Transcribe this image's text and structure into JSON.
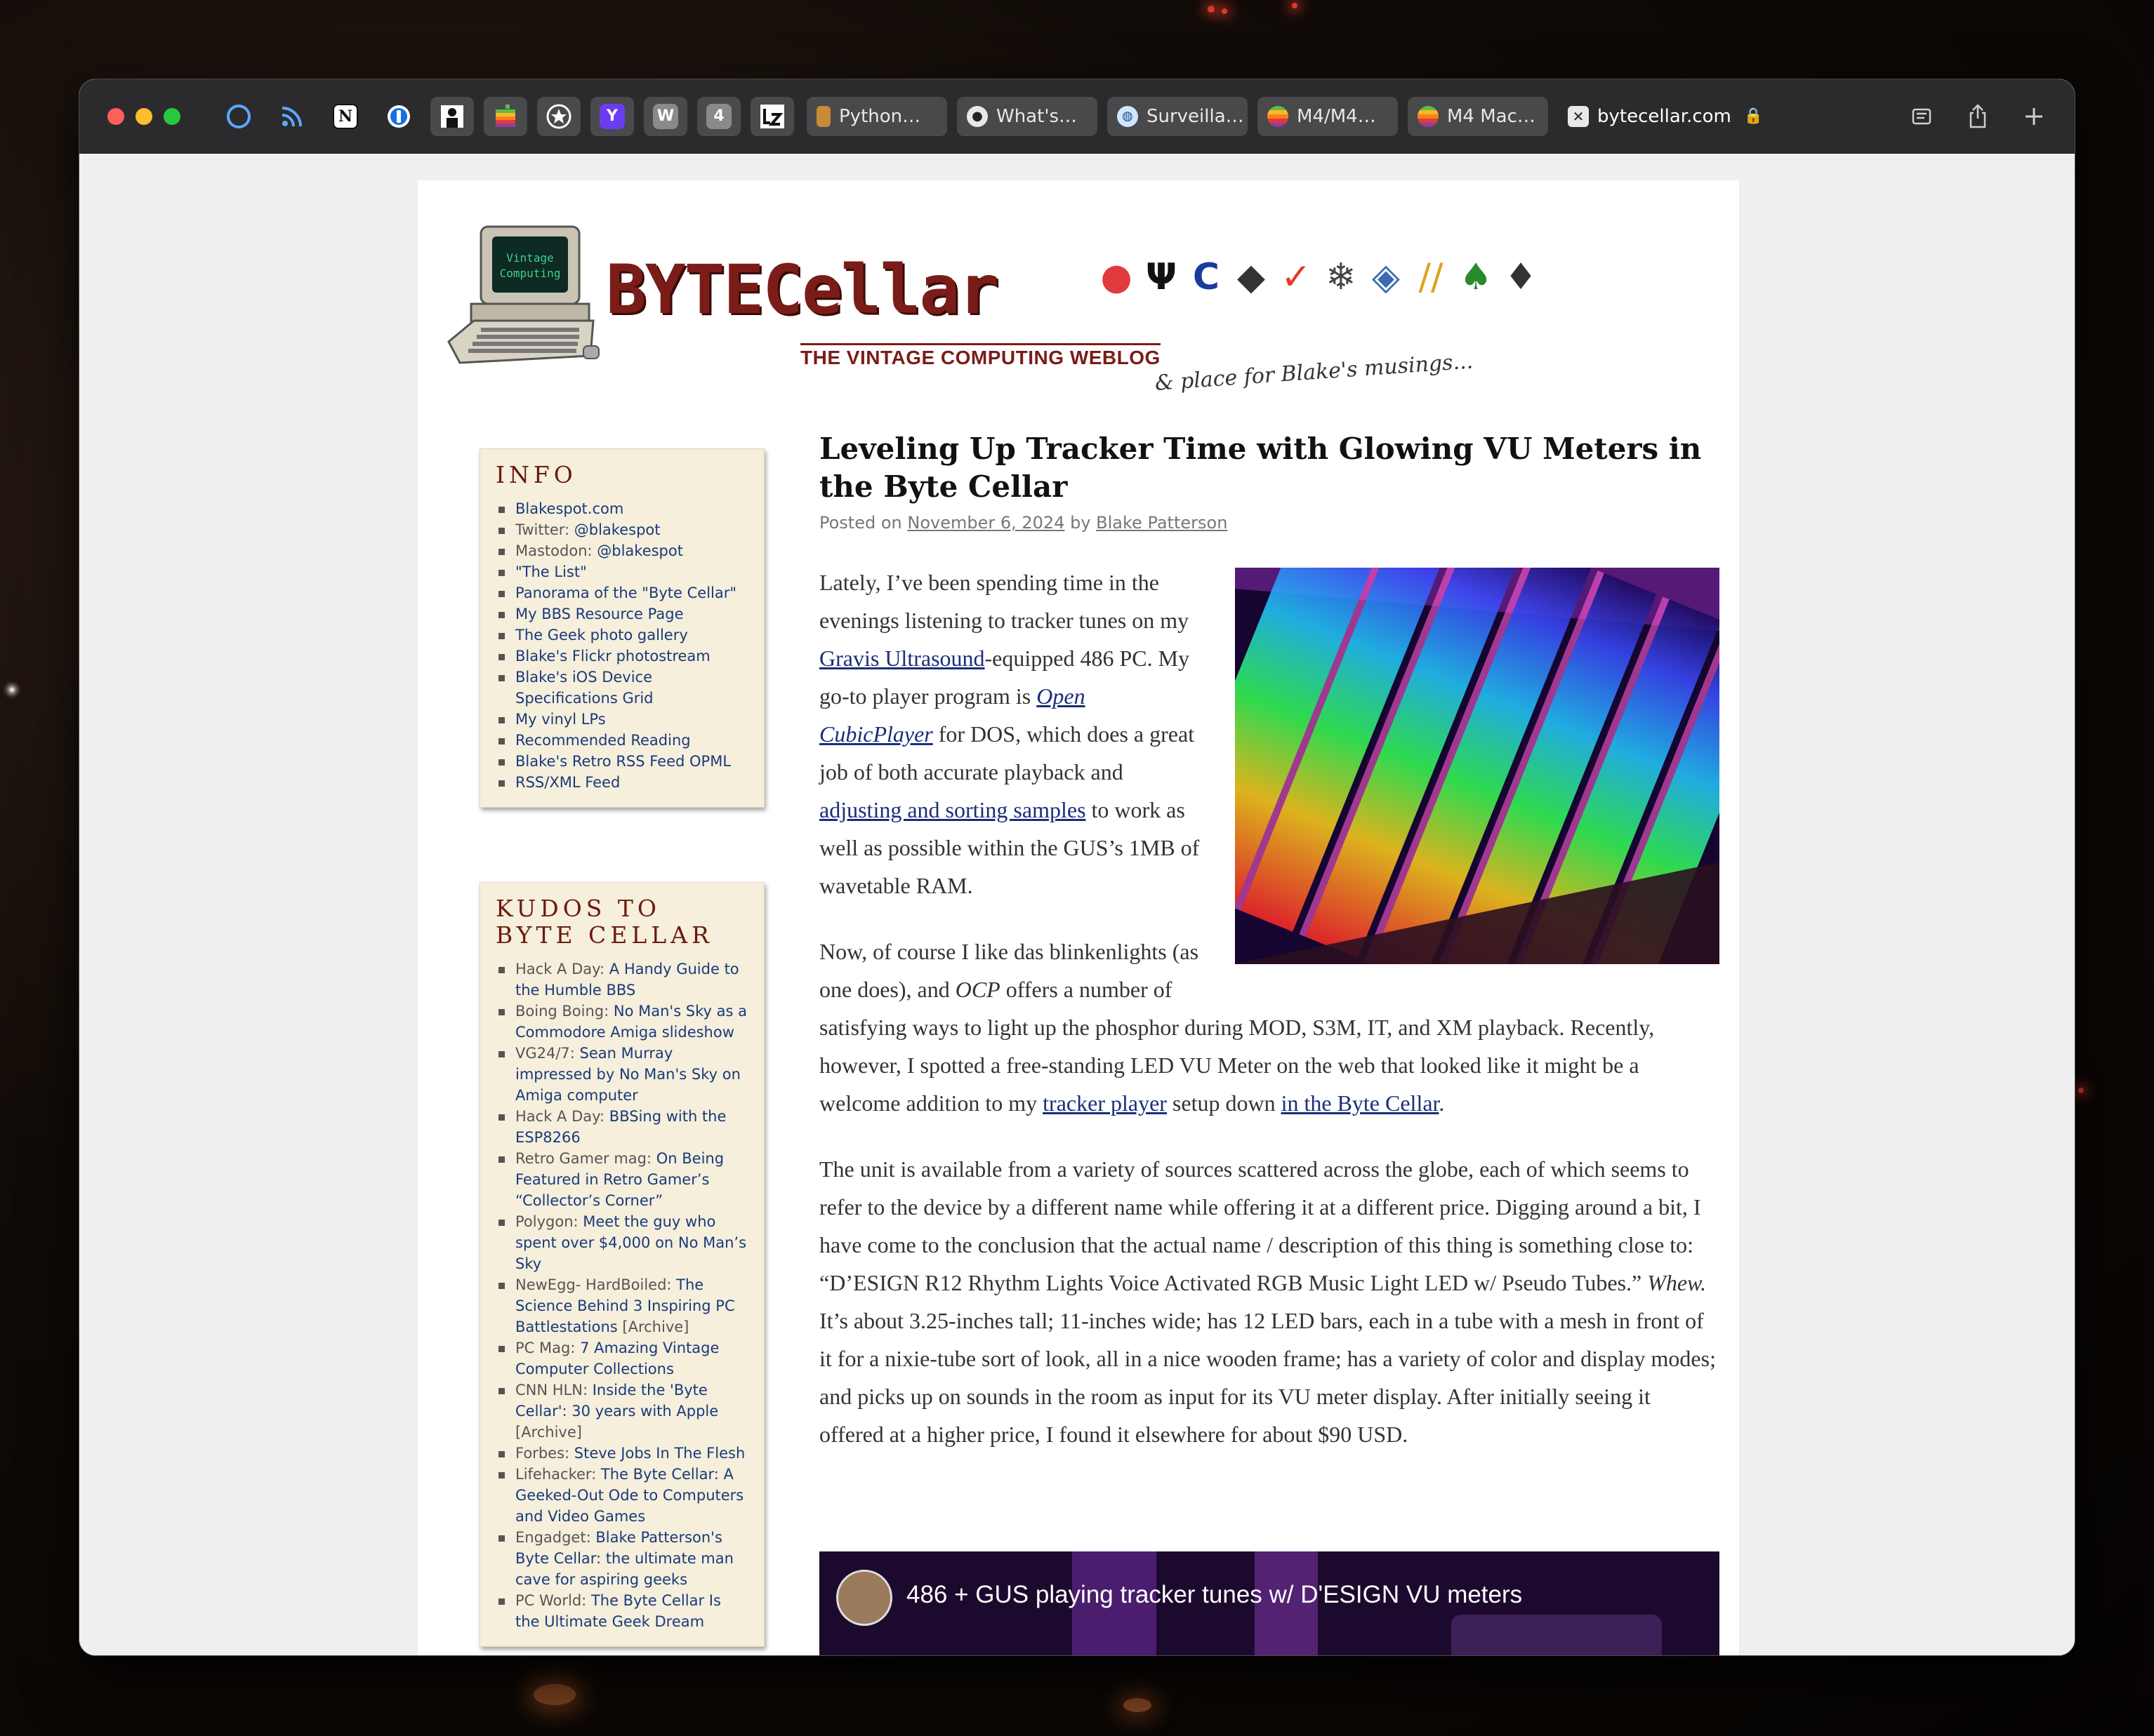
{
  "browser": {
    "pinned_tabs": [
      {
        "icon": "moon-icon",
        "label": ""
      },
      {
        "icon": "rss-icon",
        "label": ""
      },
      {
        "icon": "notion-icon",
        "label": "N"
      },
      {
        "icon": "onepassword-icon",
        "label": ""
      },
      {
        "icon": "person-icon",
        "label": ""
      },
      {
        "icon": "apple-rainbow-icon",
        "label": ""
      },
      {
        "icon": "star-badge-icon",
        "label": ""
      },
      {
        "icon": "y-letter-icon",
        "label": "Y"
      },
      {
        "icon": "w-letter-icon",
        "label": "W"
      },
      {
        "icon": "four-badge-icon",
        "label": "4"
      },
      {
        "icon": "lz-icon",
        "label": ""
      }
    ],
    "tabs": [
      {
        "label": "Python…",
        "icon": "bottle-icon"
      },
      {
        "label": "What's…",
        "icon": "github-icon"
      },
      {
        "label": "Surveilla…",
        "icon": "globe-icon"
      },
      {
        "label": "M4/M4…",
        "icon": "apple-rainbow-icon"
      },
      {
        "label": "M4 Mac…",
        "icon": "apple-rainbow-icon"
      }
    ],
    "active_tab": {
      "label": "bytecellar.com",
      "icon": "close-icon"
    }
  },
  "header": {
    "logo": "BYTECellar",
    "tagline": "THE VINTAGE COMPUTING WEBLOG",
    "musing": "& place for Blake's musings...",
    "screen_text": "Vintage Computing"
  },
  "sidebar": {
    "info": {
      "title": "INFO",
      "items": [
        {
          "text": "Blakespot.com"
        },
        {
          "pre": "Twitter: ",
          "text": "@blakespot"
        },
        {
          "pre": "Mastodon: ",
          "text": "@blakespot"
        },
        {
          "text": "\"The List\""
        },
        {
          "text": "Panorama of the \"Byte Cellar\""
        },
        {
          "text": "My BBS Resource Page"
        },
        {
          "text": "The Geek photo gallery"
        },
        {
          "text": "Blake's Flickr photostream"
        },
        {
          "text": "Blake's iOS Device Specifications Grid"
        },
        {
          "text": "My vinyl LPs"
        },
        {
          "text": "Recommended Reading"
        },
        {
          "text": "Blake's Retro RSS Feed OPML"
        },
        {
          "text": "RSS/XML Feed"
        }
      ]
    },
    "kudos": {
      "title": "KUDOS TO BYTE CELLAR",
      "items": [
        {
          "pre": "Hack A Day: ",
          "text": "A Handy Guide to the Humble BBS"
        },
        {
          "pre": "Boing Boing: ",
          "text": "No Man's Sky as a Commodore Amiga slideshow"
        },
        {
          "pre": "VG24/7: ",
          "text": "Sean Murray impressed by No Man's Sky on Amiga computer"
        },
        {
          "pre": "Hack A Day: ",
          "text": "BBSing with the ESP8266"
        },
        {
          "pre": "Retro Gamer mag: ",
          "text": "On Being Featured in Retro Gamer’s “Collector’s Corner”"
        },
        {
          "pre": "Polygon: ",
          "text": "Meet the guy who spent over $4,000 on No Man’s Sky"
        },
        {
          "pre": "NewEgg- HardBoiled: ",
          "text": "The Science Behind 3 Inspiring PC Battlestations",
          "post": " [Archive]"
        },
        {
          "pre": "PC Mag: ",
          "text": "7 Amazing Vintage Computer Collections"
        },
        {
          "pre": "CNN HLN: ",
          "text": "Inside the 'Byte Cellar': 30 years with Apple",
          "post": " [Archive]"
        },
        {
          "pre": "Forbes: ",
          "text": "Steve Jobs In The Flesh"
        },
        {
          "pre": "Lifehacker: ",
          "text": "The Byte Cellar: A Geeked-Out Ode to Computers and Video Games"
        },
        {
          "pre": "Engadget: ",
          "text": "Blake Patterson's Byte Cellar: the ultimate man cave for aspiring geeks"
        },
        {
          "pre": "PC World: ",
          "text": "The Byte Cellar Is the Ultimate Geek Dream"
        }
      ]
    }
  },
  "article": {
    "title": "Leveling Up Tracker Time with Glowing VU Meters in the Byte Cellar",
    "meta_prefix": "Posted on ",
    "date": "November 6, 2024",
    "meta_by": " by ",
    "author": "Blake Patterson",
    "p1": {
      "a": "Lately, I’ve been spending time in the evenings listening to tracker tunes on my ",
      "link1": "Gravis Ultrasound",
      "b": "-equipped 486 PC. My go-to player program is ",
      "link2": "Open CubicPlayer",
      "c": " for DOS, which does a great job of both accurate playback and ",
      "link3": "adjusting and sorting samples",
      "d": " to work as well as possible within the GUS’s 1MB of wavetable RAM."
    },
    "p2": {
      "a": "Now, of course I like das blinkenlights (as one does), and ",
      "em": "OCP",
      "b": " offers a number of satisfying ways to light up the phosphor during MOD, S3M, IT, and XM playback. Recently, however, I spotted a free-standing LED VU Meter on the web that looked like it might be a welcome addition to my ",
      "link1": "tracker player",
      "c": " setup down ",
      "link2": "in the Byte Cellar",
      "d": "."
    },
    "p3": {
      "a": "The unit is available from a variety of sources scattered across the globe, each of which seems to refer to the device by a different name while offering it at a different price. Digging around a bit, I have come to the conclusion that the actual name / description of this thing is something close to: “D’ESIGN R12 Rhythm Lights Voice Activated RGB Music Light LED w/ Pseudo Tubes.” ",
      "em": "Whew.",
      "b": " It’s about 3.25-inches tall; 11-inches wide; has 12 LED bars, each in a tube with a mesh in front of it for a nixie-tube sort of look, all in a nice wooden frame; has a variety of color and display modes; and picks up on sounds in the room as input for its VU meter display. After initially seeing it offered at a higher price, I found it elsewhere for about $90 USD."
    },
    "video_title": "486 + GUS playing tracker tunes w/ D'ESIGN VU meters"
  }
}
